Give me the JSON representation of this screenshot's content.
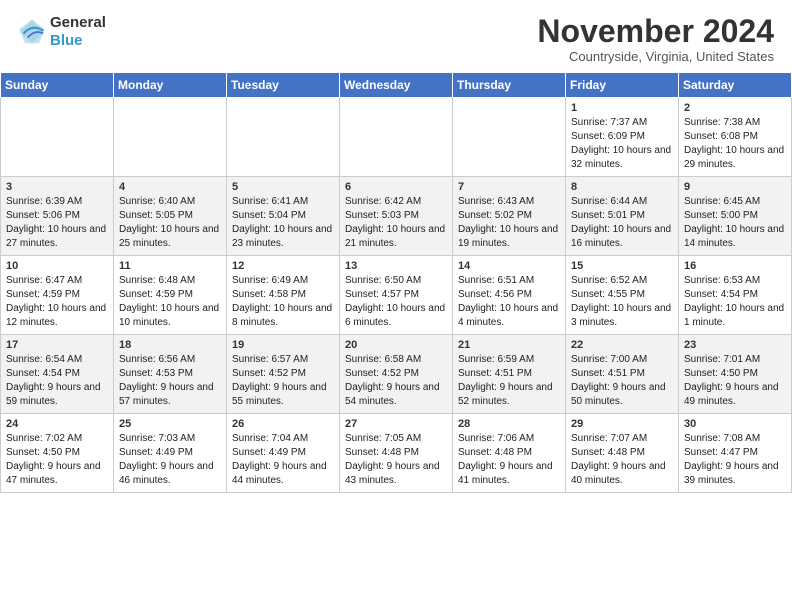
{
  "header": {
    "logo": {
      "general": "General",
      "blue": "Blue"
    },
    "month_title": "November 2024",
    "subtitle": "Countryside, Virginia, United States"
  },
  "calendar": {
    "days_of_week": [
      "Sunday",
      "Monday",
      "Tuesday",
      "Wednesday",
      "Thursday",
      "Friday",
      "Saturday"
    ],
    "weeks": [
      [
        {
          "day": "",
          "info": ""
        },
        {
          "day": "",
          "info": ""
        },
        {
          "day": "",
          "info": ""
        },
        {
          "day": "",
          "info": ""
        },
        {
          "day": "",
          "info": ""
        },
        {
          "day": "1",
          "info": "Sunrise: 7:37 AM\nSunset: 6:09 PM\nDaylight: 10 hours and 32 minutes."
        },
        {
          "day": "2",
          "info": "Sunrise: 7:38 AM\nSunset: 6:08 PM\nDaylight: 10 hours and 29 minutes."
        }
      ],
      [
        {
          "day": "3",
          "info": "Sunrise: 6:39 AM\nSunset: 5:06 PM\nDaylight: 10 hours and 27 minutes."
        },
        {
          "day": "4",
          "info": "Sunrise: 6:40 AM\nSunset: 5:05 PM\nDaylight: 10 hours and 25 minutes."
        },
        {
          "day": "5",
          "info": "Sunrise: 6:41 AM\nSunset: 5:04 PM\nDaylight: 10 hours and 23 minutes."
        },
        {
          "day": "6",
          "info": "Sunrise: 6:42 AM\nSunset: 5:03 PM\nDaylight: 10 hours and 21 minutes."
        },
        {
          "day": "7",
          "info": "Sunrise: 6:43 AM\nSunset: 5:02 PM\nDaylight: 10 hours and 19 minutes."
        },
        {
          "day": "8",
          "info": "Sunrise: 6:44 AM\nSunset: 5:01 PM\nDaylight: 10 hours and 16 minutes."
        },
        {
          "day": "9",
          "info": "Sunrise: 6:45 AM\nSunset: 5:00 PM\nDaylight: 10 hours and 14 minutes."
        }
      ],
      [
        {
          "day": "10",
          "info": "Sunrise: 6:47 AM\nSunset: 4:59 PM\nDaylight: 10 hours and 12 minutes."
        },
        {
          "day": "11",
          "info": "Sunrise: 6:48 AM\nSunset: 4:59 PM\nDaylight: 10 hours and 10 minutes."
        },
        {
          "day": "12",
          "info": "Sunrise: 6:49 AM\nSunset: 4:58 PM\nDaylight: 10 hours and 8 minutes."
        },
        {
          "day": "13",
          "info": "Sunrise: 6:50 AM\nSunset: 4:57 PM\nDaylight: 10 hours and 6 minutes."
        },
        {
          "day": "14",
          "info": "Sunrise: 6:51 AM\nSunset: 4:56 PM\nDaylight: 10 hours and 4 minutes."
        },
        {
          "day": "15",
          "info": "Sunrise: 6:52 AM\nSunset: 4:55 PM\nDaylight: 10 hours and 3 minutes."
        },
        {
          "day": "16",
          "info": "Sunrise: 6:53 AM\nSunset: 4:54 PM\nDaylight: 10 hours and 1 minute."
        }
      ],
      [
        {
          "day": "17",
          "info": "Sunrise: 6:54 AM\nSunset: 4:54 PM\nDaylight: 9 hours and 59 minutes."
        },
        {
          "day": "18",
          "info": "Sunrise: 6:56 AM\nSunset: 4:53 PM\nDaylight: 9 hours and 57 minutes."
        },
        {
          "day": "19",
          "info": "Sunrise: 6:57 AM\nSunset: 4:52 PM\nDaylight: 9 hours and 55 minutes."
        },
        {
          "day": "20",
          "info": "Sunrise: 6:58 AM\nSunset: 4:52 PM\nDaylight: 9 hours and 54 minutes."
        },
        {
          "day": "21",
          "info": "Sunrise: 6:59 AM\nSunset: 4:51 PM\nDaylight: 9 hours and 52 minutes."
        },
        {
          "day": "22",
          "info": "Sunrise: 7:00 AM\nSunset: 4:51 PM\nDaylight: 9 hours and 50 minutes."
        },
        {
          "day": "23",
          "info": "Sunrise: 7:01 AM\nSunset: 4:50 PM\nDaylight: 9 hours and 49 minutes."
        }
      ],
      [
        {
          "day": "24",
          "info": "Sunrise: 7:02 AM\nSunset: 4:50 PM\nDaylight: 9 hours and 47 minutes."
        },
        {
          "day": "25",
          "info": "Sunrise: 7:03 AM\nSunset: 4:49 PM\nDaylight: 9 hours and 46 minutes."
        },
        {
          "day": "26",
          "info": "Sunrise: 7:04 AM\nSunset: 4:49 PM\nDaylight: 9 hours and 44 minutes."
        },
        {
          "day": "27",
          "info": "Sunrise: 7:05 AM\nSunset: 4:48 PM\nDaylight: 9 hours and 43 minutes."
        },
        {
          "day": "28",
          "info": "Sunrise: 7:06 AM\nSunset: 4:48 PM\nDaylight: 9 hours and 41 minutes."
        },
        {
          "day": "29",
          "info": "Sunrise: 7:07 AM\nSunset: 4:48 PM\nDaylight: 9 hours and 40 minutes."
        },
        {
          "day": "30",
          "info": "Sunrise: 7:08 AM\nSunset: 4:47 PM\nDaylight: 9 hours and 39 minutes."
        }
      ]
    ]
  }
}
